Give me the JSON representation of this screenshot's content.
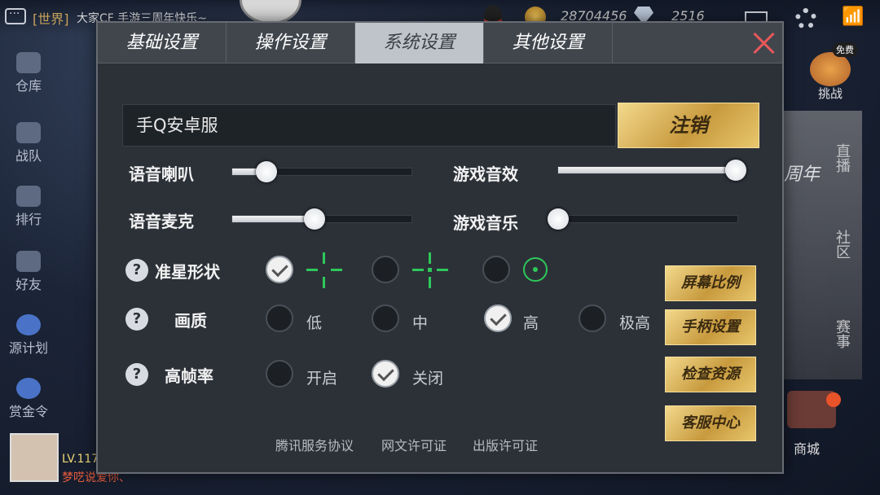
{
  "hud": {
    "chat_tag": "[世界]",
    "chat_text": "大家CF 手游三周年快乐~",
    "coins": "28704456",
    "gems": "2516"
  },
  "left_menu": [
    "仓库",
    "战队",
    "排行",
    "好友",
    "源计划",
    "赏金令"
  ],
  "right_side": {
    "free_tag": "免费",
    "challenge": "挑战",
    "live": "直播",
    "community": "社区",
    "match": "赛事",
    "shop": "商城",
    "banner": "周年"
  },
  "player": {
    "level": "LV.117",
    "name": "梦呓说爱你、"
  },
  "settings": {
    "tabs": [
      "基础设置",
      "操作设置",
      "系统设置",
      "其他设置"
    ],
    "active_tab": "系统设置",
    "account": "手Q安卓服",
    "logout": "注销",
    "sliders": {
      "voice_speaker": {
        "label": "语音喇叭",
        "value": 0.19
      },
      "voice_mic": {
        "label": "语音麦克",
        "value": 0.46
      },
      "game_sfx": {
        "label": "游戏音效",
        "value": 0.99
      },
      "game_music": {
        "label": "游戏音乐",
        "value": 0.0
      }
    },
    "crosshair": {
      "label": "准星形状",
      "help": "?",
      "selected": 0
    },
    "quality": {
      "label": "画质",
      "help": "?",
      "options": [
        "低",
        "中",
        "高",
        "极高"
      ],
      "selected": 2
    },
    "high_fps": {
      "label": "高帧率",
      "help": "?",
      "options": [
        "开启",
        "关闭"
      ],
      "selected": 1
    },
    "side_buttons": [
      "屏幕比例",
      "手柄设置",
      "检查资源",
      "客服中心"
    ],
    "footer_links": [
      "腾讯服务协议",
      "网文许可证",
      "出版许可证"
    ]
  },
  "colors": {
    "accent_gold": "#c89a3e",
    "crosshair_green": "#2ec85a",
    "close_red": "#e8585a"
  }
}
